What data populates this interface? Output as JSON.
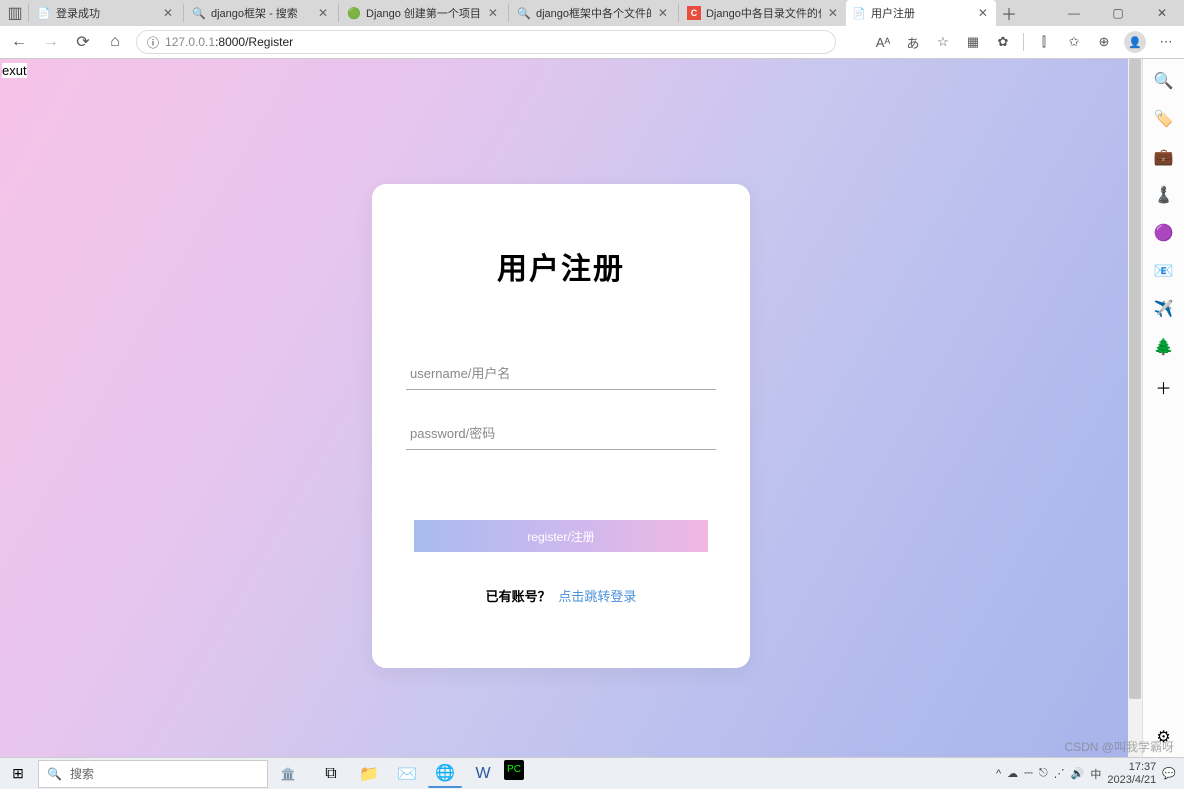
{
  "tabs": [
    {
      "icon": "📄",
      "title": "登录成功"
    },
    {
      "icon": "🔍",
      "title": "django框架 - 搜索",
      "iconColor": "#3b8"
    },
    {
      "icon": "🟢",
      "title": "Django 创建第一个项目"
    },
    {
      "icon": "🔍",
      "title": "django框架中各个文件的",
      "iconColor": "#3b8"
    },
    {
      "icon": "C",
      "title": "Django中各目录文件的作",
      "iconBg": "#e74c3c"
    },
    {
      "icon": "📄",
      "title": "用户注册",
      "active": true
    }
  ],
  "window": {
    "min": "—",
    "max": "▢",
    "close": "✕"
  },
  "addr": {
    "info_icon": "ⓘ",
    "host": "127.0.0.1",
    "port_path": ":8000/Register",
    "icons": {
      "read": "Aᴬ",
      "trans": "あ",
      "star": "☆",
      "ext1": "▦",
      "ext2": "✿",
      "split": "⫿",
      "collect": "✩",
      "collect2": "⊕",
      "more": "⋯"
    }
  },
  "page": {
    "topleft": "exut",
    "heading": "用户注册",
    "username_ph": "username/用户名",
    "password_ph": "password/密码",
    "register_btn": "register/注册",
    "have_account": "已有账号？",
    "goto_login": "点击跳转登录"
  },
  "sidebar": {
    "items": [
      "🔍",
      "🏷️",
      "💼",
      "♟️",
      "🟣",
      "📧",
      "✈️",
      "🌲"
    ],
    "add": "＋",
    "gear": "⚙"
  },
  "taskbar": {
    "search_ph": "搜索",
    "tray": {
      "ime": "中",
      "net": "⎋",
      "wifi": "⋰",
      "vol": "🔊",
      "bat": "⎓",
      "up": "^"
    },
    "time": "17:37",
    "date": "2023/4/21",
    "watermark": "CSDN @叫我学霸呀"
  }
}
